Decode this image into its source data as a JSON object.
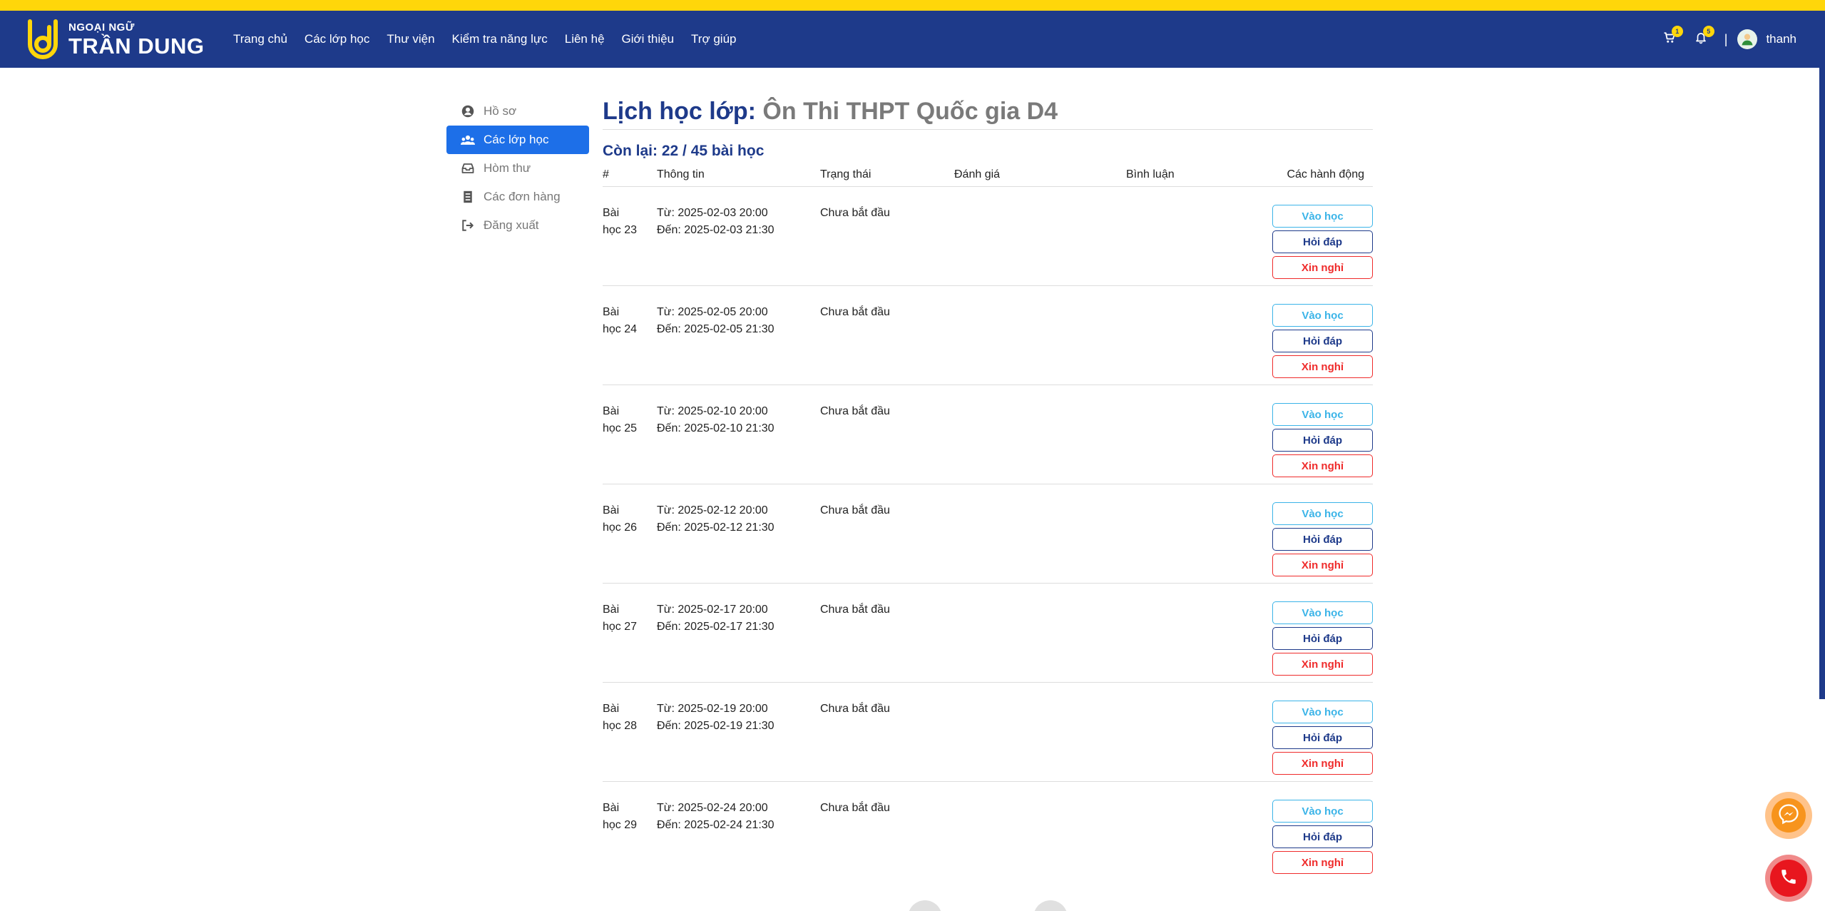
{
  "brand": {
    "small": "NGOẠI NGỮ",
    "big": "TRẦN DUNG",
    "accent": "#ffd60a",
    "nav_bg": "#1e3a8a"
  },
  "nav": {
    "items": [
      {
        "label": "Trang chủ"
      },
      {
        "label": "Các lớp học"
      },
      {
        "label": "Thư viện"
      },
      {
        "label": "Kiểm tra năng lực"
      },
      {
        "label": "Liên hệ"
      },
      {
        "label": "Giới thiệu"
      },
      {
        "label": "Trợ giúp"
      }
    ],
    "cart_count": "1",
    "notif_count": "5",
    "separator": "|",
    "username": "thanh"
  },
  "sidebar": {
    "items": [
      {
        "label": "Hồ sơ",
        "icon": "user-circle-icon"
      },
      {
        "label": "Các lớp học",
        "icon": "users-icon",
        "active": true
      },
      {
        "label": "Hòm thư",
        "icon": "inbox-icon"
      },
      {
        "label": "Các đơn hàng",
        "icon": "receipt-icon"
      },
      {
        "label": "Đăng xuất",
        "icon": "logout-icon"
      }
    ]
  },
  "main": {
    "title_prefix": "Lịch học lớp:",
    "class_name": "Ôn Thi THPT Quốc gia D4",
    "remaining": "Còn lại: 22 / 45 bài học",
    "columns": [
      "#",
      "Thông tin",
      "Trạng thái",
      "Đánh giá",
      "Bình luận",
      "Các hành động"
    ],
    "buttons": {
      "join": "Vào học",
      "qa": "Hỏi đáp",
      "leave": "Xin nghỉ"
    },
    "lessons": [
      {
        "num_a": "Bài",
        "num_b": "học 23",
        "from": "Từ: 2025-02-03 20:00",
        "to": "Đến: 2025-02-03 21:30",
        "status": "Chưa bắt đầu"
      },
      {
        "num_a": "Bài",
        "num_b": "học 24",
        "from": "Từ: 2025-02-05 20:00",
        "to": "Đến: 2025-02-05 21:30",
        "status": "Chưa bắt đầu"
      },
      {
        "num_a": "Bài",
        "num_b": "học 25",
        "from": "Từ: 2025-02-10 20:00",
        "to": "Đến: 2025-02-10 21:30",
        "status": "Chưa bắt đầu"
      },
      {
        "num_a": "Bài",
        "num_b": "học 26",
        "from": "Từ: 2025-02-12 20:00",
        "to": "Đến: 2025-02-12 21:30",
        "status": "Chưa bắt đầu"
      },
      {
        "num_a": "Bài",
        "num_b": "học 27",
        "from": "Từ: 2025-02-17 20:00",
        "to": "Đến: 2025-02-17 21:30",
        "status": "Chưa bắt đầu"
      },
      {
        "num_a": "Bài",
        "num_b": "học 28",
        "from": "Từ: 2025-02-19 20:00",
        "to": "Đến: 2025-02-19 21:30",
        "status": "Chưa bắt đầu"
      },
      {
        "num_a": "Bài",
        "num_b": "học 29",
        "from": "Từ: 2025-02-24 20:00",
        "to": "Đến: 2025-02-24 21:30",
        "status": "Chưa bắt đầu"
      }
    ]
  },
  "floating": {
    "messenger_icon": "messenger-icon",
    "phone_icon": "phone-icon"
  }
}
